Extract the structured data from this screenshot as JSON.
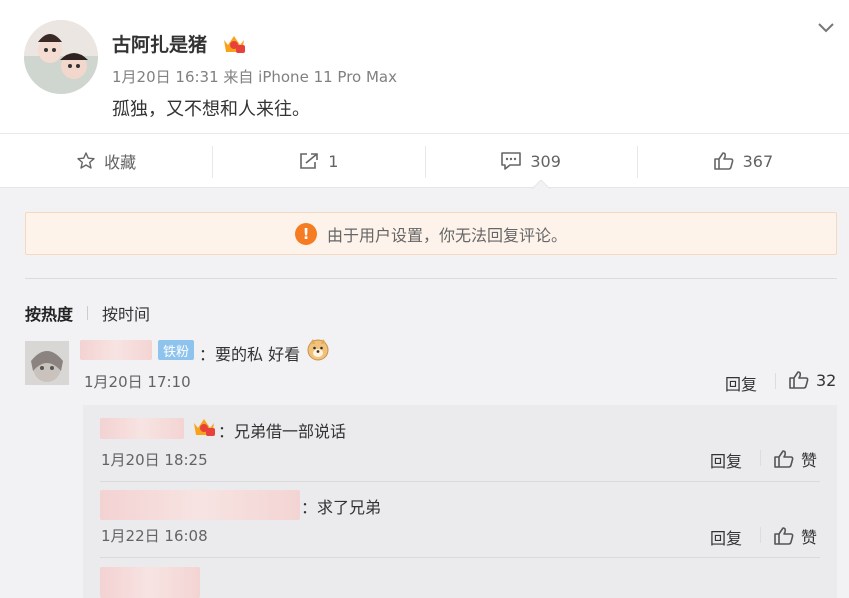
{
  "post": {
    "username": "古阿扎是猪",
    "meta": "1月20日 16:31 来自 iPhone 11 Pro Max",
    "text": "孤独，又不想和人来往。",
    "actions": {
      "favorite_label": "收藏",
      "repost_count": "1",
      "comment_count": "309",
      "like_count": "367"
    }
  },
  "notice": {
    "text": "由于用户设置，你无法回复评论。"
  },
  "sort": {
    "hot_label": "按热度",
    "time_label": "按时间"
  },
  "comments": [
    {
      "badge": "铁粉",
      "text": "：要的私 好看",
      "time": "1月20日 17:10",
      "reply_label": "回复",
      "like_count": "32"
    }
  ],
  "replies": [
    {
      "text": "：兄弟借一部说话",
      "time": "1月20日 18:25",
      "reply_label": "回复",
      "like_label": "赞"
    },
    {
      "text": "：求了兄弟",
      "time": "1月22日 16:08",
      "reply_label": "回复",
      "like_label": "赞"
    }
  ],
  "colors": {
    "accent_orange": "#f57c22",
    "fan_badge": "#8ec3ee",
    "notice_bg": "#fdf3ea"
  }
}
